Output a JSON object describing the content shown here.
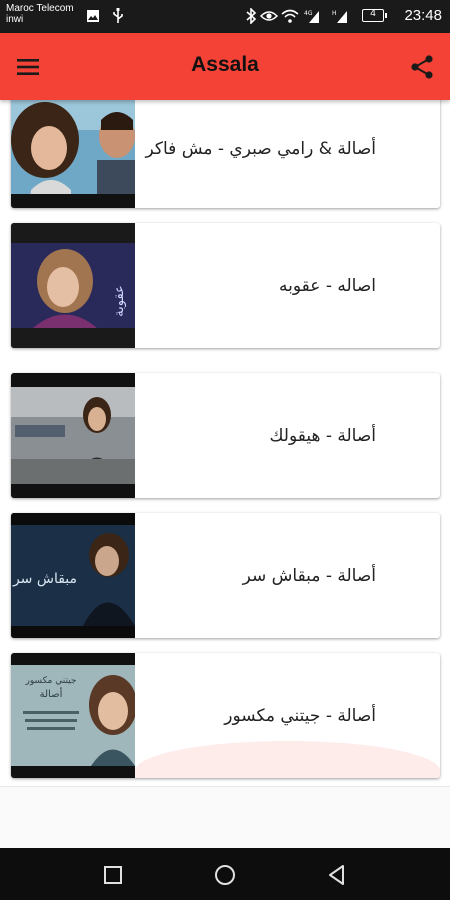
{
  "status_bar": {
    "carrier_line1": "Maroc Telecom",
    "carrier_line2": "inwi",
    "battery_level": "4",
    "time": "23:48",
    "icons": [
      "image-icon",
      "usb-icon",
      "bluetooth-icon",
      "eye-icon",
      "wifi-icon",
      "signal-icon",
      "battery-icon"
    ]
  },
  "app_bar": {
    "title": "Assala",
    "background_color": "#f44336",
    "menu_icon": "hamburger-menu-icon",
    "share_icon": "share-icon"
  },
  "songs": [
    {
      "title": "أصالة & رامي صبري - مش فاكر"
    },
    {
      "title": "اصاله - عقوبه",
      "thumbnail_text": "عقوبة"
    },
    {
      "title": "أصالة - هيقولك"
    },
    {
      "title": "أصالة - مبقاش سر",
      "thumbnail_text": "مبقاش سر"
    },
    {
      "title": "أصالة - جيتني مكسور",
      "thumbnail_text": [
        "جيتني مكسور",
        "أصالة"
      ]
    }
  ],
  "nav_bar": {
    "icons": [
      "recent-apps-icon",
      "home-icon",
      "back-icon"
    ]
  }
}
